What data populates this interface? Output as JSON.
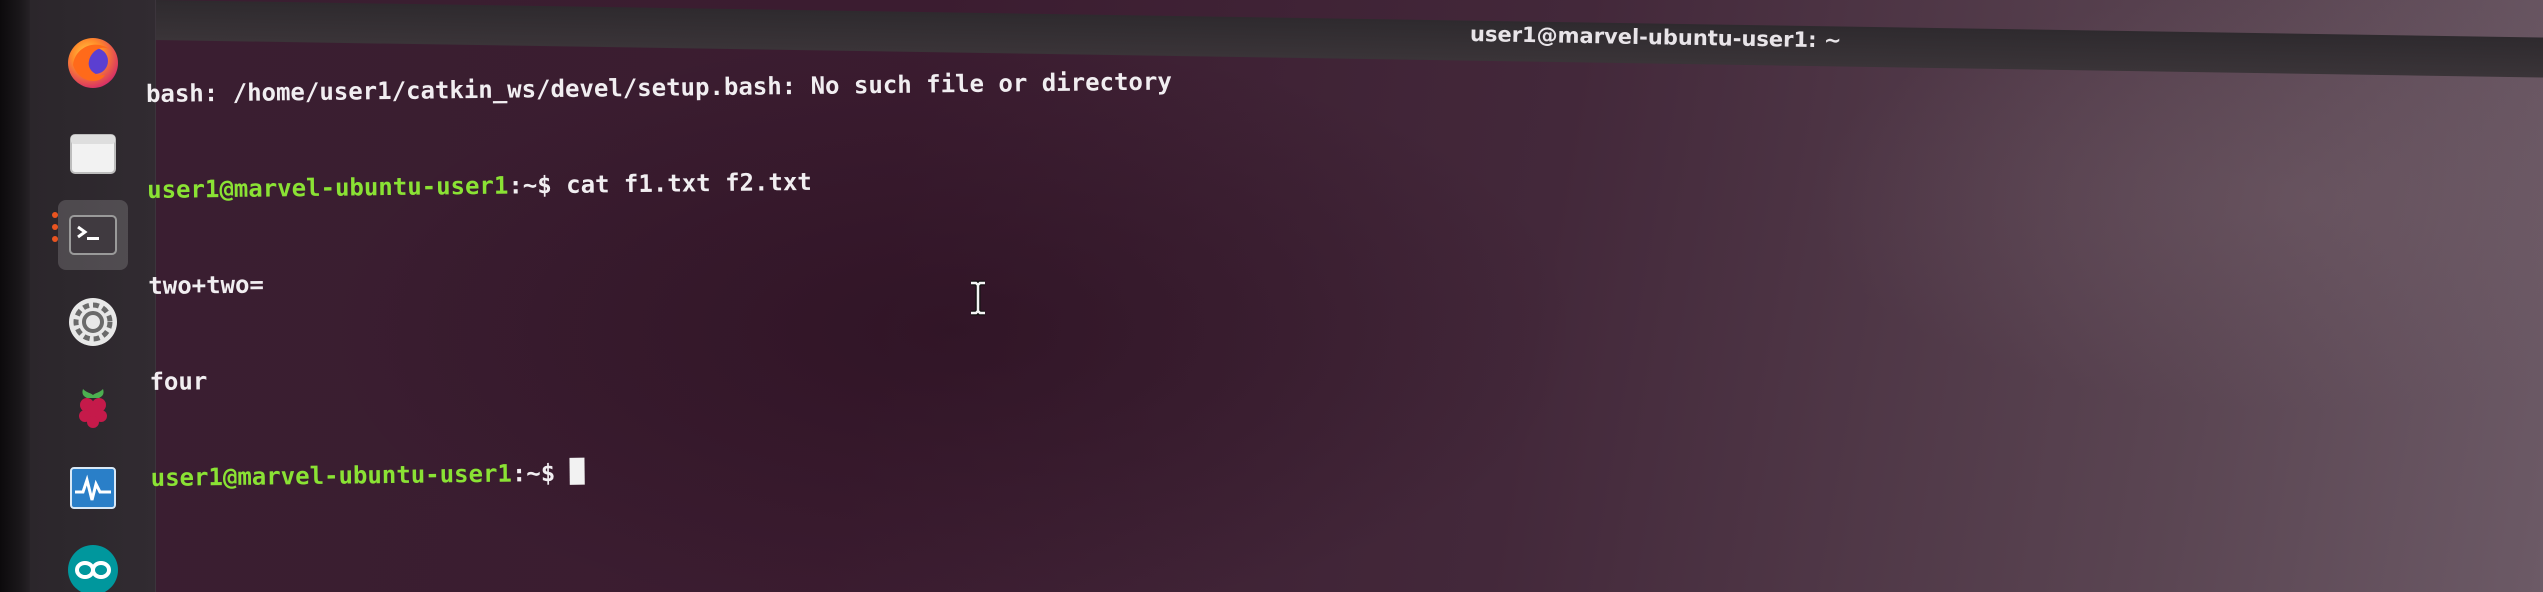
{
  "window": {
    "title": "user1@marvel-ubuntu-user1: ~"
  },
  "dock": {
    "items": [
      {
        "name": "firefox",
        "icon": "firefox-icon",
        "active": false
      },
      {
        "name": "files",
        "icon": "files-icon",
        "active": false
      },
      {
        "name": "terminal",
        "icon": "terminal-icon",
        "active": true
      },
      {
        "name": "settings",
        "icon": "gear-icon",
        "active": false
      },
      {
        "name": "raspberry-pi",
        "icon": "raspberry-icon",
        "active": false
      },
      {
        "name": "system-monitor",
        "icon": "system-monitor-icon",
        "active": false
      },
      {
        "name": "arduino",
        "icon": "arduino-icon",
        "active": false
      }
    ]
  },
  "terminal": {
    "lines": [
      {
        "prompt": "",
        "text": "bash: /home/user1/catkin_ws/devel/setup.bash: No such file or directory"
      },
      {
        "prompt": "user1@marvel-ubuntu-user1",
        "suffix": ":~$",
        "text": " cat f1.txt f2.txt"
      },
      {
        "prompt": "",
        "text": "two+two="
      },
      {
        "prompt": "",
        "text": "four"
      },
      {
        "prompt": "user1@marvel-ubuntu-user1",
        "suffix": ":~$",
        "text": " "
      }
    ]
  },
  "colors": {
    "prompt": "#8ae234",
    "text": "#f1eef1",
    "accent": "#e95420",
    "background": "#3b1c30"
  }
}
